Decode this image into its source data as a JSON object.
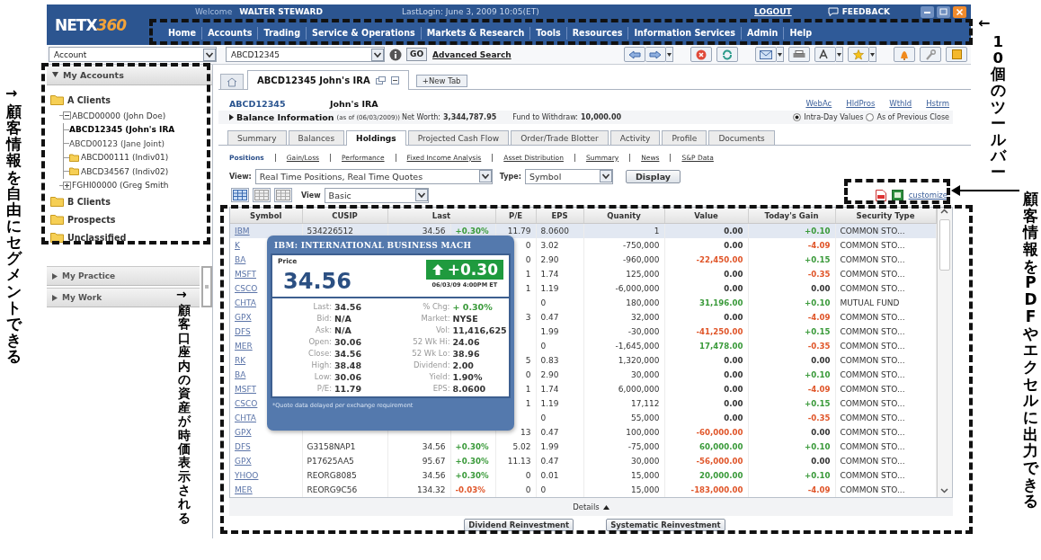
{
  "header": {
    "logo_main": "NETX",
    "logo_accent": "360",
    "welcome_label": "Welcome",
    "user": "WALTER STEWARD",
    "last_login": "LastLogin: June 3, 2009 10:05(ET)",
    "logout": "LOGOUT",
    "feedback": "FEEDBACK"
  },
  "menu": [
    "Home",
    "Accounts",
    "Trading",
    "Service & Operations",
    "Markets & Research",
    "Tools",
    "Resources",
    "Information Services",
    "Admin",
    "Help"
  ],
  "search": {
    "scope": "Account",
    "account": "ABCD12345",
    "go": "GO",
    "advanced": "Advanced Search"
  },
  "sidebar": {
    "header": "My Accounts",
    "expanded": true,
    "tree": [
      {
        "label": "A Clients",
        "kind": "folder",
        "children": [
          {
            "label": "ABCD00000 (John Doe)",
            "kind": "group",
            "expanded": true,
            "children": [
              {
                "label": "ABCD12345 (John's IRA",
                "kind": "account",
                "selected": true
              },
              {
                "label": "ABCD00123 (Jane Joint)",
                "kind": "account",
                "selected": false
              },
              {
                "label": "ABCD00111 (Indiv01)",
                "kind": "flagged",
                "selected": false
              },
              {
                "label": "ABCD34567 (Indiv02)",
                "kind": "flagged",
                "selected": false
              }
            ]
          },
          {
            "label": "FGHI00000 (Greg Smith",
            "kind": "group",
            "expanded": false
          }
        ]
      },
      {
        "label": "B Clients",
        "kind": "folder"
      },
      {
        "label": "Prospects",
        "kind": "folder"
      },
      {
        "label": "Unclassified",
        "kind": "folder"
      }
    ],
    "sections": [
      {
        "label": "My Practice",
        "expanded": false
      },
      {
        "label": "My Work",
        "expanded": false
      }
    ]
  },
  "doc_tabs": [
    {
      "label": "ABCD12345 John's IRA",
      "selected": true
    }
  ],
  "new_tab": "+New Tab",
  "account": {
    "id": "ABCD12345",
    "name": "John's IRA",
    "links": [
      "WebAc",
      "HldPros",
      "Wthld",
      "Hstrm"
    ],
    "balance_title": "Balance Information",
    "as_of": "(as of (06/03/2009))",
    "net_worth_label": "Net Worth:",
    "net_worth": "3,344,787.95",
    "withdraw_label": "Fund to Withdraw:",
    "withdraw": "10,000.00",
    "value_modes": [
      {
        "label": "Intra-Day Values",
        "selected": true
      },
      {
        "label": "As of Previous Close",
        "selected": false
      }
    ]
  },
  "tabs": [
    {
      "label": "Summary",
      "selected": false
    },
    {
      "label": "Balances",
      "selected": false
    },
    {
      "label": "Holdings",
      "selected": true
    },
    {
      "label": "Projected Cash Flow",
      "selected": false
    },
    {
      "label": "Order/Trade Blotter",
      "selected": false
    },
    {
      "label": "Activity",
      "selected": false
    },
    {
      "label": "Profile",
      "selected": false
    },
    {
      "label": "Documents",
      "selected": false
    }
  ],
  "subnav": [
    {
      "label": "Positions",
      "selected": true
    },
    {
      "label": "Gain/Loss",
      "selected": false
    },
    {
      "label": "Performance",
      "selected": false
    },
    {
      "label": "Fixed Income Analysis",
      "selected": false
    },
    {
      "label": "Asset Distribution",
      "selected": false
    },
    {
      "label": "Summary",
      "selected": false
    },
    {
      "label": "News",
      "selected": false
    },
    {
      "label": "S&P Data",
      "selected": false
    }
  ],
  "filters": {
    "view_label": "View:",
    "view": "Real Time Positions, Real Time Quotes",
    "type_label": "Type:",
    "type": "Symbol",
    "display": "Display",
    "layout_label": "View",
    "layout": "Basic",
    "customize": "customize"
  },
  "table": {
    "columns": [
      "Symbol",
      "CUSIP",
      "Last",
      "P/E",
      "EPS",
      "Quanity",
      "Value",
      "Today's Gain",
      "Security Type"
    ],
    "rows": [
      {
        "symbol": "IBM",
        "cusip": "534226512",
        "last": "34.56",
        "chg": {
          "text": "+0.30%",
          "color": "#3a9a3a"
        },
        "pe": "11.79",
        "eps": "8.0600",
        "quantity": "1",
        "value": {
          "text": "0.00",
          "color": "#333333"
        },
        "gain": {
          "text": "+0.10",
          "color": "#3a9a3a"
        },
        "type": "COMMON STO...",
        "selected": true
      },
      {
        "symbol": "K",
        "pe": "0",
        "eps": "3.02",
        "quantity": "-750,000",
        "value": {
          "text": "0.00",
          "color": "#333333"
        },
        "gain": {
          "text": "-4.09",
          "color": "#e0562a"
        },
        "type": "COMMON STO...",
        "selected": false
      },
      {
        "symbol": "BA",
        "pe": "0",
        "eps": "2.90",
        "quantity": "-960,000",
        "value": {
          "text": "-22,450.00",
          "color": "#e0562a"
        },
        "gain": {
          "text": "+0.15",
          "color": "#3a9a3a"
        },
        "type": "COMMON STO...",
        "selected": false
      },
      {
        "symbol": "MSFT",
        "pe": "1",
        "eps": "1.74",
        "quantity": "125,000",
        "value": {
          "text": "0.00",
          "color": "#333333"
        },
        "gain": {
          "text": "-0.35",
          "color": "#e0562a"
        },
        "type": "COMMON STO...",
        "selected": false
      },
      {
        "symbol": "CSCO",
        "pe": "1",
        "eps": "1.19",
        "quantity": "-6,000,000",
        "value": {
          "text": "0.00",
          "color": "#333333"
        },
        "gain": {
          "text": "0.00",
          "color": "#333333"
        },
        "type": "COMMON STO...",
        "selected": false
      },
      {
        "symbol": "CHTA",
        "eps": "0",
        "quantity": "180,000",
        "value": {
          "text": "31,196.00",
          "color": "#3a9a3a"
        },
        "gain": {
          "text": "+0.10",
          "color": "#3a9a3a"
        },
        "type": "MUTUAL FUND",
        "selected": false
      },
      {
        "symbol": "GPX",
        "pe": "3",
        "eps": "0.47",
        "quantity": "32,000",
        "value": {
          "text": "0.00",
          "color": "#333333"
        },
        "gain": {
          "text": "-4.09",
          "color": "#e0562a"
        },
        "type": "COMMON STO...",
        "selected": false
      },
      {
        "symbol": "DFS",
        "eps": "1.99",
        "quantity": "-30,000",
        "value": {
          "text": "-41,250.00",
          "color": "#e0562a"
        },
        "gain": {
          "text": "+0.15",
          "color": "#3a9a3a"
        },
        "type": "COMMON STO...",
        "selected": false
      },
      {
        "symbol": "MER",
        "eps": "0",
        "quantity": "-1,645,000",
        "value": {
          "text": "17,478.00",
          "color": "#3a9a3a"
        },
        "gain": {
          "text": "-0.35",
          "color": "#e0562a"
        },
        "type": "COMMON STO...",
        "selected": false
      },
      {
        "symbol": "RK",
        "pe": "5",
        "eps": "0.83",
        "quantity": "1,320,000",
        "value": {
          "text": "0.00",
          "color": "#333333"
        },
        "gain": {
          "text": "0.00",
          "color": "#333333"
        },
        "type": "COMMON STO...",
        "selected": false
      },
      {
        "symbol": "BA",
        "pe": "0",
        "eps": "2.90",
        "quantity": "30,000",
        "value": {
          "text": "0.00",
          "color": "#333333"
        },
        "gain": {
          "text": "+0.10",
          "color": "#3a9a3a"
        },
        "type": "COMMON STO...",
        "selected": false
      },
      {
        "symbol": "MSFT",
        "pe": "1",
        "eps": "1.74",
        "quantity": "6,000,000",
        "value": {
          "text": "0.00",
          "color": "#333333"
        },
        "gain": {
          "text": "-4.09",
          "color": "#e0562a"
        },
        "type": "COMMON STO...",
        "selected": false
      },
      {
        "symbol": "CSCO",
        "pe": "1",
        "eps": "1.19",
        "quantity": "17,112",
        "value": {
          "text": "0.00",
          "color": "#333333"
        },
        "gain": {
          "text": "+0.15",
          "color": "#3a9a3a"
        },
        "type": "COMMON STO...",
        "selected": false
      },
      {
        "symbol": "CHTA",
        "eps": "0",
        "quantity": "55,000",
        "value": {
          "text": "0.00",
          "color": "#333333"
        },
        "gain": {
          "text": "-0.35",
          "color": "#e0562a"
        },
        "type": "COMMON STO...",
        "selected": false
      },
      {
        "symbol": "GPX",
        "pe": "13",
        "eps": "0.47",
        "quantity": "100,000",
        "value": {
          "text": "-60,000.00",
          "color": "#e0562a"
        },
        "gain": {
          "text": "0.00",
          "color": "#333333"
        },
        "type": "COMMON STO...",
        "selected": false
      },
      {
        "symbol": "DFS",
        "cusip": "G3158NAP1",
        "last": "34.56",
        "chg": {
          "text": "+0.30%",
          "color": "#3a9a3a"
        },
        "pe": "5.02",
        "eps": "1.99",
        "quantity": "-75,000",
        "value": {
          "text": "60,000.00",
          "color": "#3a9a3a"
        },
        "gain": {
          "text": "+0.10",
          "color": "#3a9a3a"
        },
        "type": "COMMON STO...",
        "selected": false
      },
      {
        "symbol": "GPX",
        "cusip": "P17625AA5",
        "last": "95.67",
        "chg": {
          "text": "+0.30%",
          "color": "#3a9a3a"
        },
        "pe": "11.13",
        "eps": "0.47",
        "quantity": "30,000",
        "value": {
          "text": "-56,000.00",
          "color": "#e0562a"
        },
        "gain": {
          "text": "0.00",
          "color": "#333333"
        },
        "type": "COMMON STO...",
        "selected": false
      },
      {
        "symbol": "YHOO",
        "cusip": "REORG8085",
        "last": "34.56",
        "chg": {
          "text": "+0.30%",
          "color": "#3a9a3a"
        },
        "pe": "0",
        "eps": "0.01",
        "quantity": "15,000",
        "value": {
          "text": "20,000.00",
          "color": "#3a9a3a"
        },
        "gain": {
          "text": "+0.10",
          "color": "#3a9a3a"
        },
        "type": "COMMON STO...",
        "selected": false
      },
      {
        "symbol": "MER",
        "cusip": "REORG9C56",
        "last": "134.32",
        "chg": {
          "text": "-0.03%",
          "color": "#e0562a"
        },
        "pe": "0",
        "eps": "0",
        "quantity": "15,000",
        "value": {
          "text": "-183,000.00",
          "color": "#e0562a"
        },
        "gain": {
          "text": "-4.09",
          "color": "#e0562a"
        },
        "type": "COMMON STO...",
        "selected": false
      }
    ]
  },
  "quote_popup": {
    "title": "IBM: INTERNATIONAL BUSINESS MACH",
    "price_label": "Price",
    "price": "34.56",
    "change": {
      "text": "+0.30",
      "color": "#1f9a3e"
    },
    "timestamp": "06/03/09 4:00PM ET",
    "stats": [
      {
        "label": "Last:",
        "value": "34.56",
        "color": "#333333"
      },
      {
        "label": "% Chg:",
        "value": "+ 0.30%",
        "color": "#3a9a3a"
      },
      {
        "label": "Bid:",
        "value": "N/A",
        "color": "#333333"
      },
      {
        "label": "Market:",
        "value": "NYSE",
        "color": "#333333"
      },
      {
        "label": "Ask:",
        "value": "N/A",
        "color": "#333333"
      },
      {
        "label": "Vol:",
        "value": "11,416,625",
        "color": "#333333"
      },
      {
        "label": "Open:",
        "value": "30.06",
        "color": "#333333"
      },
      {
        "label": "52 Wk Hi:",
        "value": "24.06",
        "color": "#333333"
      },
      {
        "label": "Close:",
        "value": "34.56",
        "color": "#333333"
      },
      {
        "label": "52 Wk Lo:",
        "value": "38.96",
        "color": "#333333"
      },
      {
        "label": "High:",
        "value": "38.48",
        "color": "#333333"
      },
      {
        "label": "Dividend:",
        "value": "2.00",
        "color": "#333333"
      },
      {
        "label": "Low:",
        "value": "30.06",
        "color": "#333333"
      },
      {
        "label": "Yield:",
        "value": "1.90%",
        "color": "#333333"
      },
      {
        "label": "P/E:",
        "value": "11.79",
        "color": "#333333"
      },
      {
        "label": "EPS:",
        "value": "8.0600",
        "color": "#333333"
      }
    ],
    "note": "*Quote data delayed per exchange requirement"
  },
  "details": "Details",
  "buttons": [
    "Dividend Reinvestment",
    "Systematic Reinvestment"
  ],
  "annotations": {
    "toolbar_arrow": "←",
    "toolbar": "10個のツールバー",
    "segment_arrow": "→",
    "segment": "顧客情報を自由にセグメントできる",
    "holdings_arrow": "→",
    "holdings": "顧客口座内の資産が時価表示される",
    "export": "顧客情報をPDFやエクセルに出力できる"
  }
}
